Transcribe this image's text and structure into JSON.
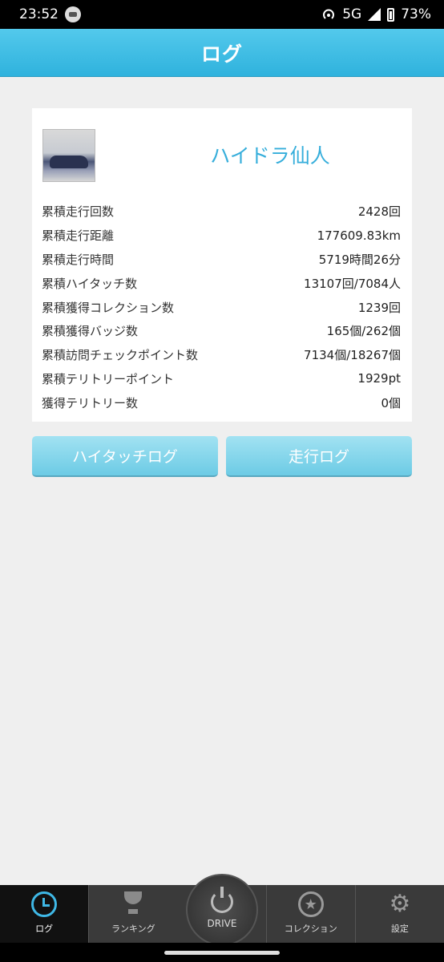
{
  "status_bar": {
    "time": "23:52",
    "network": "5G",
    "battery": "73%"
  },
  "header": {
    "title": "ログ"
  },
  "profile": {
    "name": "ハイドラ仙人"
  },
  "stats": [
    {
      "label": "累積走行回数",
      "value": "2428回"
    },
    {
      "label": "累積走行距離",
      "value": "177609.83km"
    },
    {
      "label": "累積走行時間",
      "value": "5719時間26分"
    },
    {
      "label": "累積ハイタッチ数",
      "value": "13107回/7084人"
    },
    {
      "label": "累積獲得コレクション数",
      "value": "1239回"
    },
    {
      "label": "累積獲得バッジ数",
      "value": "165個/262個"
    },
    {
      "label": "累積訪問チェックポイント数",
      "value": "7134個/18267個"
    },
    {
      "label": "累積テリトリーポイント",
      "value": "1929pt"
    },
    {
      "label": "獲得テリトリー数",
      "value": "0個"
    }
  ],
  "buttons": {
    "hightouch_log": "ハイタッチログ",
    "run_log": "走行ログ"
  },
  "bottom_nav": {
    "log": "ログ",
    "ranking": "ランキング",
    "drive": "DRIVE",
    "collection": "コレクション",
    "settings": "設定"
  },
  "colors": {
    "accent": "#36aedb",
    "header": "#3dbde6",
    "button": "#86d4ea"
  }
}
